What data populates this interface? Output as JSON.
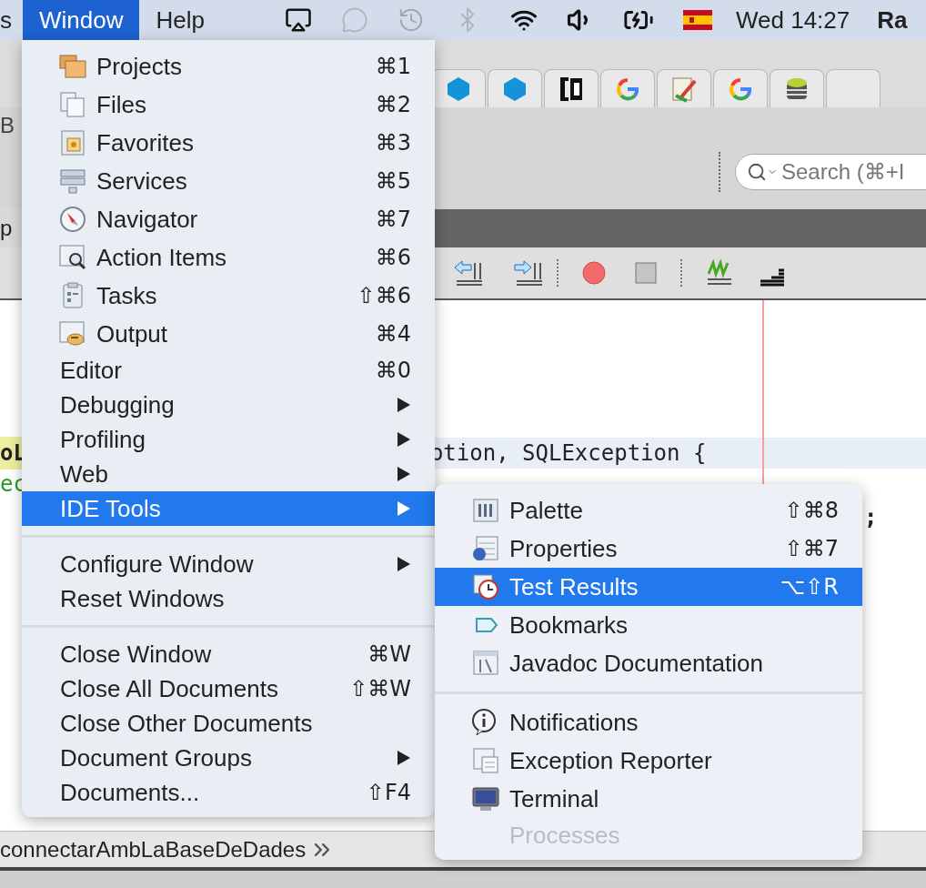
{
  "menubar": {
    "menus": [
      {
        "label": "s",
        "selected": false
      },
      {
        "label": "Window",
        "selected": true
      },
      {
        "label": "Help",
        "selected": false
      }
    ],
    "clock": "Wed 14:27",
    "user": "Ra"
  },
  "ide": {
    "title_fragment": "B",
    "search": {
      "placeholder": "Search (⌘+I"
    },
    "editor_tab": "p",
    "code_fragments": [
      {
        "text": "oL",
        "kind": "highlight"
      },
      {
        "text": "ec",
        "kind": "comment"
      }
    ],
    "code_line": "otion, SQLException {",
    "code_tail": ";",
    "breadcrumb": "connectarAmbLaBaseDeDades"
  },
  "menu": {
    "groups": [
      [
        {
          "label": "Projects",
          "shortcut": "⌘1",
          "submenu": false,
          "selected": false
        },
        {
          "label": "Files",
          "shortcut": "⌘2",
          "submenu": false,
          "selected": false
        },
        {
          "label": "Favorites",
          "shortcut": "⌘3",
          "submenu": false,
          "selected": false
        },
        {
          "label": "Services",
          "shortcut": "⌘5",
          "submenu": false,
          "selected": false
        },
        {
          "label": "Navigator",
          "shortcut": "⌘7",
          "submenu": false,
          "selected": false
        },
        {
          "label": "Action Items",
          "shortcut": "⌘6",
          "submenu": false,
          "selected": false
        },
        {
          "label": "Tasks",
          "shortcut": "⇧⌘6",
          "submenu": false,
          "selected": false
        },
        {
          "label": "Output",
          "shortcut": "⌘4",
          "submenu": false,
          "selected": false
        },
        {
          "label": "Editor",
          "shortcut": "⌘0",
          "submenu": false,
          "selected": false
        },
        {
          "label": "Debugging",
          "submenu": true,
          "selected": false
        },
        {
          "label": "Profiling",
          "submenu": true,
          "selected": false
        },
        {
          "label": "Web",
          "submenu": true,
          "selected": false
        },
        {
          "label": "IDE Tools",
          "submenu": true,
          "selected": true
        }
      ],
      [
        {
          "label": "Configure Window",
          "submenu": true,
          "selected": false
        },
        {
          "label": "Reset Windows",
          "submenu": false,
          "selected": false
        }
      ],
      [
        {
          "label": "Close Window",
          "shortcut": "⌘W",
          "submenu": false,
          "selected": false
        },
        {
          "label": "Close All Documents",
          "shortcut": "⇧⌘W",
          "submenu": false,
          "selected": false
        },
        {
          "label": "Close Other Documents",
          "submenu": false,
          "selected": false
        },
        {
          "label": "Document Groups",
          "submenu": true,
          "selected": false
        },
        {
          "label": "Documents...",
          "shortcut": "⇧F4",
          "submenu": false,
          "selected": false
        }
      ]
    ]
  },
  "submenu": {
    "groups": [
      [
        {
          "label": "Palette",
          "shortcut": "⇧⌘8",
          "selected": false,
          "disabled": false
        },
        {
          "label": "Properties",
          "shortcut": "⇧⌘7",
          "selected": false,
          "disabled": false
        },
        {
          "label": "Test Results",
          "shortcut": "⌥⇧R",
          "selected": true,
          "disabled": false
        },
        {
          "label": "Bookmarks",
          "selected": false,
          "disabled": false
        },
        {
          "label": "Javadoc Documentation",
          "selected": false,
          "disabled": false
        }
      ],
      [
        {
          "label": "Notifications",
          "selected": false,
          "disabled": false
        },
        {
          "label": "Exception Reporter",
          "selected": false,
          "disabled": false
        },
        {
          "label": "Terminal",
          "selected": false,
          "disabled": false
        },
        {
          "label": "Processes",
          "selected": false,
          "disabled": true
        }
      ]
    ]
  }
}
